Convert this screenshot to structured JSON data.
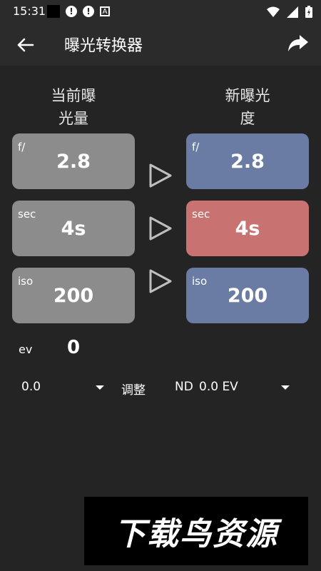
{
  "status_bar": {
    "time": "15:31"
  },
  "app_bar": {
    "title": "曝光转换器"
  },
  "headers": {
    "current": "当前曝\n光量",
    "new": "新曝光\n度"
  },
  "current": [
    {
      "label": "f/",
      "value": "2.8"
    },
    {
      "label": "sec",
      "value": "4s"
    },
    {
      "label": "iso",
      "value": "200"
    }
  ],
  "new": [
    {
      "label": "f/",
      "value": "2.8"
    },
    {
      "label": "sec",
      "value": "4s"
    },
    {
      "label": "iso",
      "value": "200"
    }
  ],
  "ev": {
    "label": "ev",
    "value": "0"
  },
  "adjust": {
    "value": "0.0",
    "label": "调整"
  },
  "nd": {
    "label": "ND",
    "value": "0.0 EV"
  },
  "watermark": {
    "text": "下载鸟资源"
  },
  "colors": {
    "current_box": "#8c8c8c",
    "new_box": "#6a7ca3",
    "highlight_box": "#c97272",
    "background": "#242424",
    "app_bar": "#2b2b2b"
  },
  "icons": [
    "back-arrow-icon",
    "share-icon",
    "play-arrow-icon",
    "dropdown-caret-icon",
    "wifi-icon",
    "signal-icon",
    "battery-icon",
    "alert-icon"
  ]
}
